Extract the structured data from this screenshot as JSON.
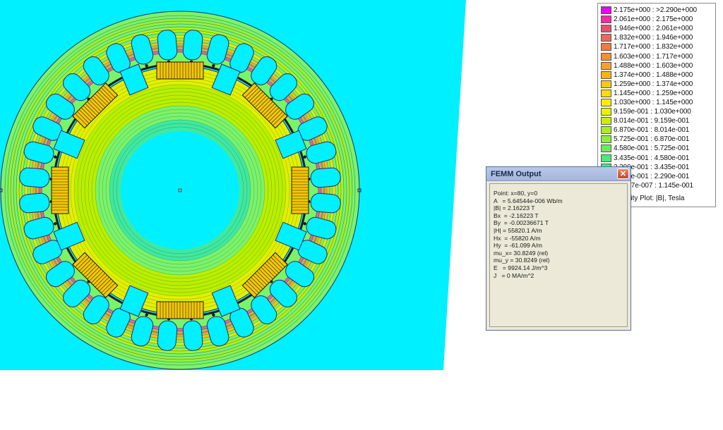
{
  "legend": {
    "entries": [
      {
        "label": "2.175e+000 : >2.290e+000",
        "color": "#ee00ee"
      },
      {
        "label": "2.061e+000 : 2.175e+000",
        "color": "#ee2ea0"
      },
      {
        "label": "1.946e+000 : 2.061e+000",
        "color": "#e8506a"
      },
      {
        "label": "1.832e+000 : 1.946e+000",
        "color": "#ec6858"
      },
      {
        "label": "1.717e+000 : 1.832e+000",
        "color": "#f07a40"
      },
      {
        "label": "1.603e+000 : 1.717e+000",
        "color": "#f49030"
      },
      {
        "label": "1.488e+000 : 1.603e+000",
        "color": "#f6a228"
      },
      {
        "label": "1.374e+000 : 1.488e+000",
        "color": "#f8b418"
      },
      {
        "label": "1.259e+000 : 1.374e+000",
        "color": "#fac810"
      },
      {
        "label": "1.145e+000 : 1.259e+000",
        "color": "#fcdc08"
      },
      {
        "label": "1.030e+000 : 1.145e+000",
        "color": "#f8ee00"
      },
      {
        "label": "9.159e-001 : 1.030e+000",
        "color": "#e6f400"
      },
      {
        "label": "8.014e-001 : 9.159e-001",
        "color": "#c8f000"
      },
      {
        "label": "6.870e-001 : 8.014e-001",
        "color": "#a8ee20"
      },
      {
        "label": "5.725e-001 : 6.870e-001",
        "color": "#8ced40"
      },
      {
        "label": "4.580e-001 : 5.725e-001",
        "color": "#6ceb58"
      },
      {
        "label": "3.435e-001 : 4.580e-001",
        "color": "#50e878"
      },
      {
        "label": "2.290e-001 : 3.435e-001",
        "color": "#3ce698"
      },
      {
        "label": "1.145e-001 : 2.290e-001",
        "color": "#20e8c0"
      },
      {
        "label": "<1.127e-007 : 1.145e-001",
        "color": "#00f0ff"
      }
    ],
    "caption": "Density Plot: |B|, Tesla"
  },
  "femm_output": {
    "title": "FEMM Output",
    "close_glyph": "✕",
    "lines": [
      "Point: x=80, y=0",
      "A   = 5.64544e-006 Wb/m",
      "|B| = 2.16223 T",
      "Bx  = -2.16223 T",
      "By  = -0.00236671 T",
      "|H| = 55820.1 A/m",
      "Hx  = -55820 A/m",
      "Hy  = -61.099 A/m",
      "mu_x= 30.8249 (rel)",
      "mu_y = 30.8249 (rel)",
      "E   = 9924.14 J/m^3",
      "J   = 0 MA/m^2"
    ]
  },
  "colors": {
    "background_region": "#00f0ff",
    "stator_yoke": "#7af36a",
    "tooth": "#d4f000",
    "flux_line": "#1a1a1a",
    "outline": "#2a2a6a"
  },
  "geometry_counts": {
    "stator_slots": 36,
    "rotor_poles": 8
  }
}
